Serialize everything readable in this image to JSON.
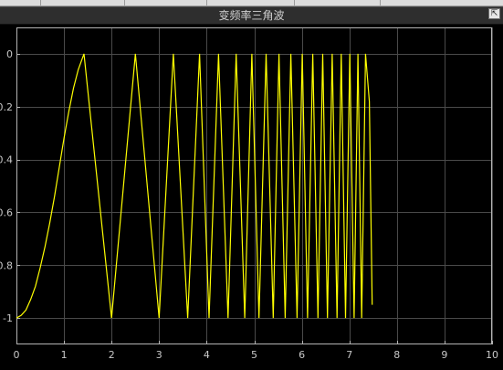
{
  "window": {
    "title": "变频率三角波",
    "restore_glyph": "⇱"
  },
  "chart_data": {
    "type": "line",
    "title": "变频率三角波",
    "xlabel": "",
    "ylabel": "",
    "xlim": [
      0,
      10
    ],
    "ylim": [
      -1.1,
      0.1
    ],
    "xticks": [
      0,
      1,
      2,
      3,
      4,
      5,
      6,
      7,
      8,
      9,
      10
    ],
    "yticks": [
      0,
      -0.2,
      -0.4,
      -0.6,
      -0.8,
      -1
    ],
    "xtick_labels": [
      "0",
      "1",
      "2",
      "3",
      "4",
      "5",
      "6",
      "7",
      "8",
      "9",
      "10"
    ],
    "ytick_labels": [
      "0",
      "0.2",
      "0.4",
      "0.6",
      "0.8",
      "-1"
    ],
    "grid": true,
    "colors": {
      "background": "#000000",
      "grid": "#4a4a4a",
      "axes": "#b4b4b4",
      "text": "#c8c8c8",
      "line": "#ffff00"
    },
    "series": [
      {
        "color": "#ffff00",
        "x": [
          0,
          0.1,
          0.2,
          0.3,
          0.4,
          0.5,
          0.6,
          0.7,
          0.8,
          0.9,
          1.0,
          1.1,
          1.2,
          1.3,
          1.42,
          2.0,
          2.5,
          3.0,
          3.3,
          3.6,
          3.85,
          4.05,
          4.25,
          4.45,
          4.62,
          4.8,
          4.95,
          5.1,
          5.25,
          5.4,
          5.52,
          5.65,
          5.77,
          5.9,
          6.01,
          6.12,
          6.23,
          6.34,
          6.44,
          6.54,
          6.64,
          6.74,
          6.83,
          6.92,
          7.01,
          7.1,
          7.18,
          7.26,
          7.34,
          7.42,
          7.48
        ],
        "y": [
          -1,
          -0.99,
          -0.97,
          -0.93,
          -0.88,
          -0.81,
          -0.73,
          -0.64,
          -0.54,
          -0.43,
          -0.32,
          -0.22,
          -0.13,
          -0.06,
          0,
          -1,
          0,
          -1,
          0,
          -1,
          0,
          -1,
          0,
          -1,
          0,
          -1,
          0,
          -1,
          0,
          -1,
          0,
          -1,
          0,
          -1,
          0,
          -1,
          0,
          -1,
          0,
          -1,
          0,
          -1,
          0,
          -1,
          0,
          -1,
          0,
          -1,
          0,
          -0.18,
          -0.95
        ]
      }
    ]
  }
}
